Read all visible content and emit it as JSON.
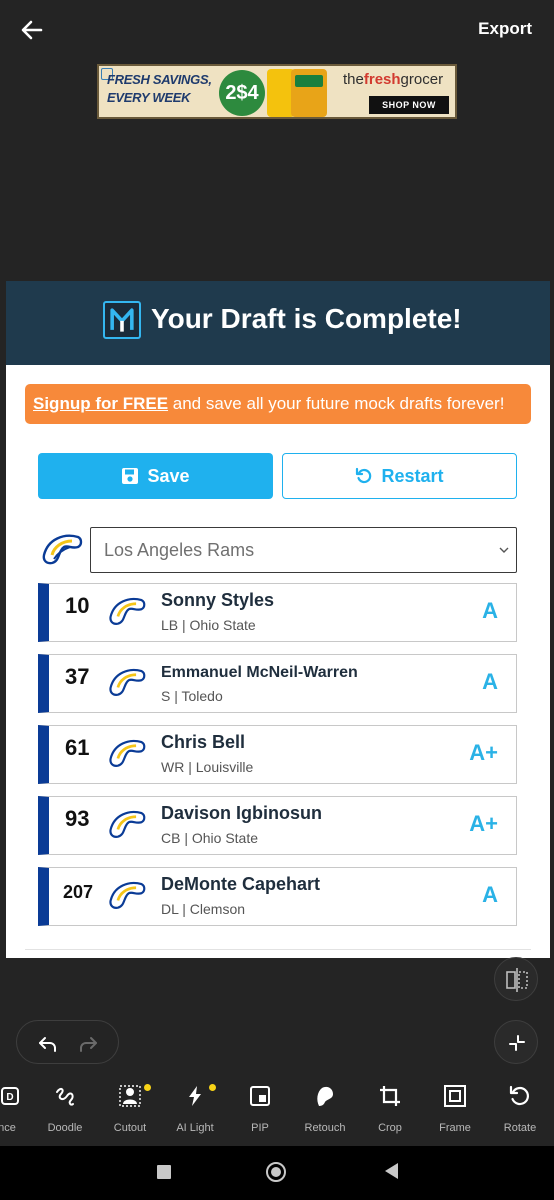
{
  "topbar": {
    "export_label": "Export"
  },
  "ad": {
    "headline": "FRESH SAVINGS, EVERY WEEK",
    "price": "2$4",
    "brand_prefix": "the",
    "brand_bold": "fresh",
    "brand_suffix": "grocer",
    "cta": "SHOP NOW"
  },
  "card": {
    "title": "Your Draft is Complete!",
    "signup_link": "Signup for FREE",
    "signup_text": " and save all your future mock drafts forever!",
    "save_label": "Save",
    "restart_label": "Restart",
    "team_select_value": "Los Angeles Rams",
    "picks": [
      {
        "number": "10",
        "name": "Sonny Styles",
        "info": "LB | Ohio State",
        "grade": "A"
      },
      {
        "number": "37",
        "name": "Emmanuel McNeil-Warren",
        "info": "S | Toledo",
        "grade": "A"
      },
      {
        "number": "61",
        "name": "Chris Bell",
        "info": "WR | Louisville",
        "grade": "A+"
      },
      {
        "number": "93",
        "name": "Davison Igbinosun",
        "info": "CB | Ohio State",
        "grade": "A+"
      },
      {
        "number": "207",
        "name": "DeMonte Capehart",
        "info": "DL | Clemson",
        "grade": "A"
      }
    ]
  },
  "tools": [
    {
      "label": "ance",
      "icon": "enhance-icon",
      "dot": false
    },
    {
      "label": "Doodle",
      "icon": "doodle-icon",
      "dot": false
    },
    {
      "label": "Cutout",
      "icon": "cutout-icon",
      "dot": true
    },
    {
      "label": "AI Light",
      "icon": "ai-light-icon",
      "dot": true
    },
    {
      "label": "PIP",
      "icon": "pip-icon",
      "dot": false
    },
    {
      "label": "Retouch",
      "icon": "retouch-icon",
      "dot": false
    },
    {
      "label": "Crop",
      "icon": "crop-icon",
      "dot": false
    },
    {
      "label": "Frame",
      "icon": "frame-icon",
      "dot": false
    },
    {
      "label": "Rotate",
      "icon": "rotate-icon",
      "dot": false
    }
  ],
  "colors": {
    "header_bg": "#1f3a4d",
    "accent_blue": "#1fb1ee",
    "signup_orange": "#f7893a",
    "team_bar": "#0a3b96",
    "grade": "#2ab2e6"
  }
}
